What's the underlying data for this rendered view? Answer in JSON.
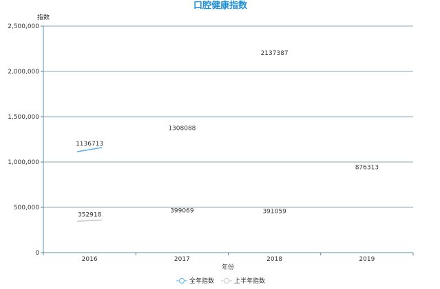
{
  "chart_data": {
    "type": "line",
    "title": "口腔健康指数",
    "xlabel": "年份",
    "ylabel": "指数",
    "categories": [
      "2016",
      "2017",
      "2018",
      "2019"
    ],
    "ylim": [
      0,
      2500000
    ],
    "yticks": [
      0,
      500000,
      1000000,
      1500000,
      2000000,
      2500000
    ],
    "ytick_labels": [
      "0",
      "500,000",
      "1,000,000",
      "1,500,000",
      "2,000,000",
      "2,500,000"
    ],
    "grid": true,
    "legend_position": "bottom",
    "series": [
      {
        "name": "全年指数",
        "color": "#5ab1ef",
        "values": [
          1136713,
          1308088,
          2137387,
          876313
        ],
        "labels": [
          "1136713",
          "1308088",
          "2137387",
          "876313"
        ]
      },
      {
        "name": "上半年指数",
        "color": "#c8c8c8",
        "values": [
          352918,
          399069,
          391059,
          null
        ],
        "labels": [
          "352918",
          "399069",
          "391059",
          ""
        ]
      }
    ]
  }
}
